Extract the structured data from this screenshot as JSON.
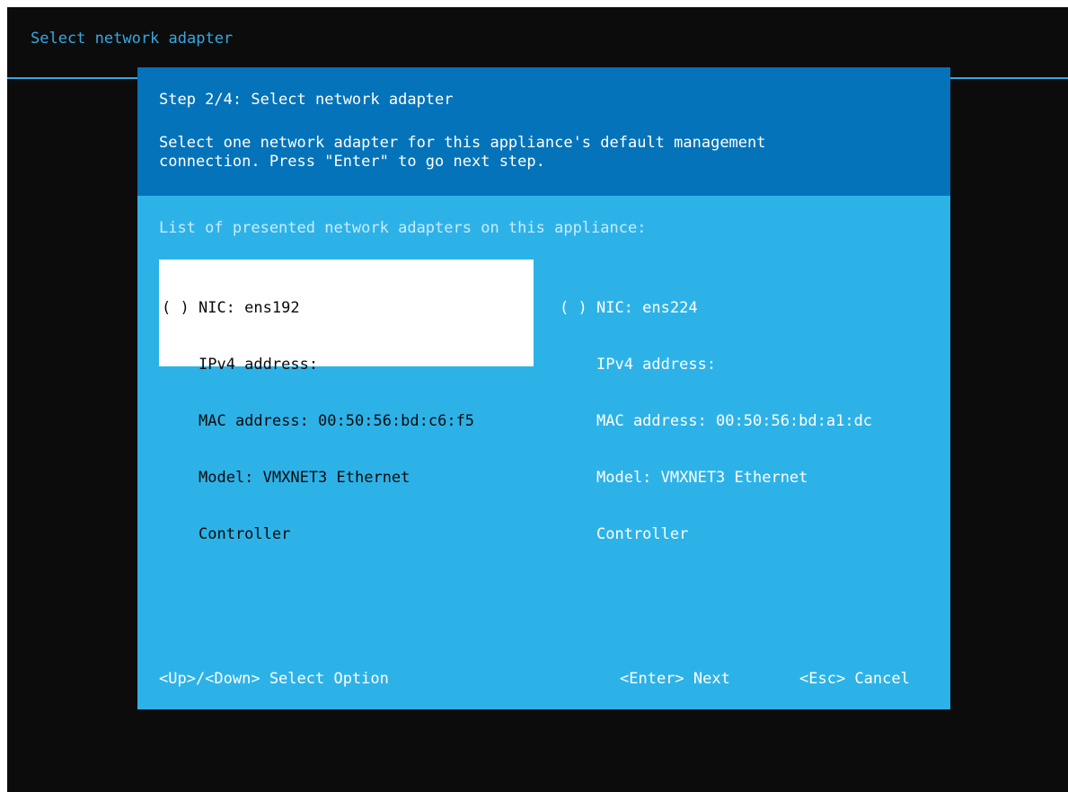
{
  "screen": {
    "title": "Select network adapter"
  },
  "dialog": {
    "step_title": "Step 2/4: Select network adapter",
    "description_line1": "Select one network adapter for this appliance's default management",
    "description_line2": "connection. Press \"Enter\" to go next step.",
    "list_heading": "List of presented network adapters on this appliance:",
    "adapters": [
      {
        "radio": "( )",
        "nic": "NIC: ens192",
        "ipv4": "IPv4 address:",
        "mac": "MAC address: 00:50:56:bd:c6:f5",
        "model_line1": "Model: VMXNET3 Ethernet",
        "model_line2": "Controller",
        "highlighted": true
      },
      {
        "radio": "( )",
        "nic": "NIC: ens224",
        "ipv4": "IPv4 address:",
        "mac": "MAC address: 00:50:56:bd:a1:dc",
        "model_line1": "Model: VMXNET3 Ethernet",
        "model_line2": "Controller",
        "highlighted": false
      }
    ],
    "footer": {
      "select_hint": "<Up>/<Down> Select Option",
      "next_hint": "<Enter> Next",
      "cancel_hint": "<Esc> Cancel"
    }
  },
  "colors": {
    "screen_bg": "#0c0c0d",
    "accent": "#36a9e1",
    "dialog_header": "#0473b9",
    "dialog_body": "#2db2e8",
    "selection_bg": "#ffffff"
  }
}
